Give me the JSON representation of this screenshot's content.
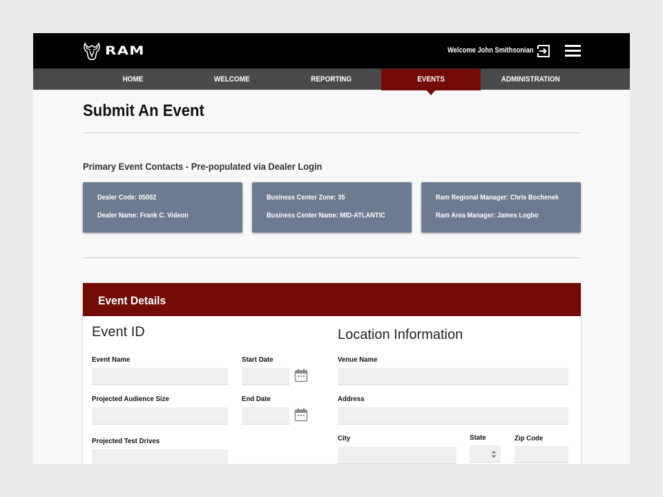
{
  "header": {
    "brand": "RAM",
    "welcome_text": "Welcome John Smithsonian",
    "logout_icon": "logout-icon",
    "menu_icon": "hamburger-menu-icon"
  },
  "nav": {
    "items": [
      {
        "label": "HOME"
      },
      {
        "label": "WELCOME"
      },
      {
        "label": "REPORTING"
      },
      {
        "label": "EVENTS",
        "active": true
      },
      {
        "label": "ADMINISTRATION"
      }
    ]
  },
  "page": {
    "title": "Submit An Event",
    "contacts_heading": "Primary Event Contacts - Pre-populated via Dealer Login"
  },
  "contacts": [
    {
      "line1": "Dealer Code: 05002",
      "line2": "Dealer Name: Frank C. Videon"
    },
    {
      "line1": "Business Center Zone: 35",
      "line2": "Business Center Name: MID-ATLANTIC"
    },
    {
      "line1": "Ram Regional Manager: Chris Bochenek",
      "line2": "Ram Area Manager: James Logbo"
    }
  ],
  "details": {
    "title": "Event Details",
    "event_section": "Event ID",
    "location_section": "Location Information",
    "fields": {
      "event_name": {
        "label": "Event Name",
        "value": ""
      },
      "start_date": {
        "label": "Start Date",
        "value": ""
      },
      "audience_size": {
        "label": "Projected Audience Size",
        "value": ""
      },
      "end_date": {
        "label": "End Date",
        "value": ""
      },
      "test_drives": {
        "label": "Projected Test Drives",
        "value": ""
      },
      "venue_name": {
        "label": "Venue Name",
        "value": ""
      },
      "address": {
        "label": "Address",
        "value": ""
      },
      "city": {
        "label": "City",
        "value": ""
      },
      "state": {
        "label": "State",
        "value": ""
      },
      "zip": {
        "label": "Zip Code",
        "value": ""
      }
    }
  },
  "colors": {
    "brand_red": "#730c06",
    "nav_gray": "#4a4a4a",
    "card_slate": "#6d7b91",
    "topbar_black": "#000000"
  }
}
